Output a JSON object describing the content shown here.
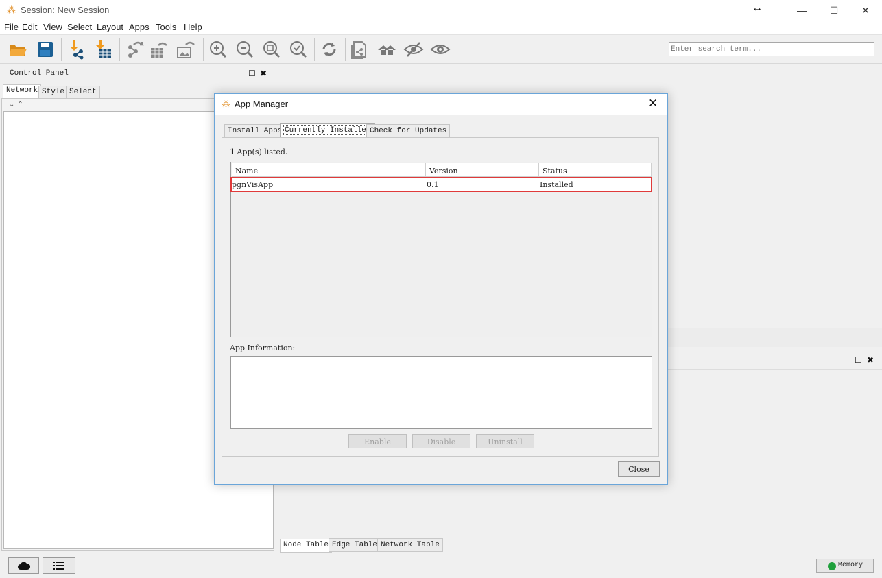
{
  "window": {
    "title": "Session: New Session",
    "minimize": "—",
    "maximize": "☐",
    "close": "✕",
    "resize_glyph": "↔"
  },
  "menu": [
    "File",
    "Edit",
    "View",
    "Select",
    "Layout",
    "Apps",
    "Tools",
    "Help"
  ],
  "toolbar": {
    "search_placeholder": "Enter search term...",
    "icons": [
      "open-folder-icon",
      "save-icon",
      "import-network-icon",
      "import-table-icon",
      "export-network-icon",
      "export-table-icon",
      "export-image-icon",
      "zoom-in-icon",
      "zoom-out-icon",
      "zoom-fit-icon",
      "zoom-selected-icon",
      "refresh-icon",
      "new-network-icon",
      "home-icon",
      "hide-icon",
      "show-icon"
    ]
  },
  "control_panel": {
    "title": "Control Panel",
    "tabs": [
      "Network",
      "Style",
      "Select"
    ],
    "expand_icons": "⯯⯭",
    "float_glyph": "☐",
    "close_glyph": "✖"
  },
  "table_panel": {
    "tabs": [
      "Node Table",
      "Edge Table",
      "Network Table"
    ],
    "float_glyph": "☐",
    "close_glyph": "✖"
  },
  "statusbar": {
    "memory_label": "Memory",
    "colors": {
      "memory_ok": "#1fa03c"
    }
  },
  "dialog": {
    "title": "App Manager",
    "close_glyph": "✕",
    "tabs": [
      "Install Apps",
      "Currently Installed",
      "Check for Updates"
    ],
    "apps_count": "1 App(s) listed.",
    "columns": [
      "Name",
      "Version",
      "Status"
    ],
    "rows": [
      {
        "name": "pgnVisApp",
        "version": "0.1",
        "status": "Installed"
      }
    ],
    "info_label": "App Information:",
    "buttons": {
      "enable": "Enable",
      "disable": "Disable",
      "uninstall": "Uninstall",
      "close": "Close"
    },
    "colors": {
      "highlight": "#e03a3a",
      "border": "#6aa5d9"
    }
  }
}
